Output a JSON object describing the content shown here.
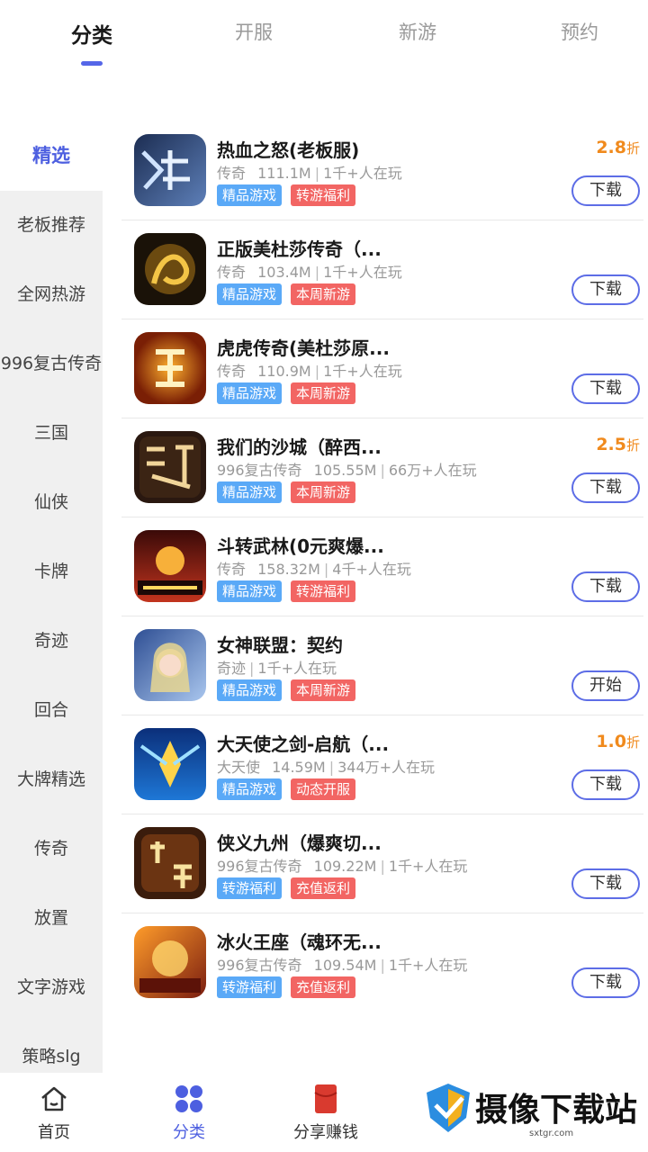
{
  "top_tabs": [
    {
      "label": "分类",
      "active": true
    },
    {
      "label": "开服",
      "active": false
    },
    {
      "label": "新游",
      "active": false
    },
    {
      "label": "预约",
      "active": false
    }
  ],
  "sidebar": [
    {
      "label": "精选",
      "active": true
    },
    {
      "label": "老板推荐"
    },
    {
      "label": "全网热游"
    },
    {
      "label": "996复古传奇"
    },
    {
      "label": "三国"
    },
    {
      "label": "仙侠"
    },
    {
      "label": "卡牌"
    },
    {
      "label": "奇迹"
    },
    {
      "label": "回合"
    },
    {
      "label": "大牌精选"
    },
    {
      "label": "传奇"
    },
    {
      "label": "放置"
    },
    {
      "label": "文字游戏"
    },
    {
      "label": "策略slg"
    }
  ],
  "games": [
    {
      "title": "热血之怒(老板服)",
      "category": "传奇",
      "size": "111.1M",
      "players": "1千+人在玩",
      "tags": [
        {
          "text": "精品游戏",
          "color": "blue"
        },
        {
          "text": "转游福利",
          "color": "red"
        }
      ],
      "discount": "2.8",
      "discount_unit": "折",
      "button": "下载",
      "icon": "ice-snow-game-icon"
    },
    {
      "title": "正版美杜莎传奇（...",
      "category": "传奇",
      "size": "103.4M",
      "players": "1千+人在玩",
      "tags": [
        {
          "text": "精品游戏",
          "color": "blue"
        },
        {
          "text": "本周新游",
          "color": "red"
        }
      ],
      "discount": "",
      "discount_unit": "",
      "button": "下载",
      "icon": "dragon-game-icon"
    },
    {
      "title": "虎虎传奇(美杜莎原...",
      "category": "传奇",
      "size": "110.9M",
      "players": "1千+人在玩",
      "tags": [
        {
          "text": "精品游戏",
          "color": "blue"
        },
        {
          "text": "本周新游",
          "color": "red"
        }
      ],
      "discount": "",
      "discount_unit": "",
      "button": "下载",
      "icon": "tiger-game-icon"
    },
    {
      "title": "我们的沙城（醉西...",
      "category": "996复古传奇",
      "size": "105.55M",
      "players": "66万+人在玩",
      "tags": [
        {
          "text": "精品游戏",
          "color": "blue"
        },
        {
          "text": "本周新游",
          "color": "red"
        }
      ],
      "discount": "2.5",
      "discount_unit": "折",
      "button": "下载",
      "icon": "zuixiyou-game-icon"
    },
    {
      "title": "斗转武林(0元爽爆...",
      "category": "传奇",
      "size": "158.32M",
      "players": "4千+人在玩",
      "tags": [
        {
          "text": "精品游戏",
          "color": "blue"
        },
        {
          "text": "转游福利",
          "color": "red"
        }
      ],
      "discount": "",
      "discount_unit": "",
      "button": "下载",
      "icon": "wulin-game-icon"
    },
    {
      "title": "女神联盟：契约",
      "category": "奇迹",
      "size": "",
      "players": "1千+人在玩",
      "tags": [
        {
          "text": "精品游戏",
          "color": "blue"
        },
        {
          "text": "本周新游",
          "color": "red"
        }
      ],
      "discount": "",
      "discount_unit": "",
      "button": "开始",
      "icon": "goddess-game-icon"
    },
    {
      "title": "大天使之剑-启航（...",
      "category": "大天使",
      "size": "14.59M",
      "players": "344万+人在玩",
      "tags": [
        {
          "text": "精品游戏",
          "color": "blue"
        },
        {
          "text": "动态开服",
          "color": "red"
        }
      ],
      "discount": "1.0",
      "discount_unit": "折",
      "button": "下载",
      "icon": "archangel-game-icon"
    },
    {
      "title": "侠义九州（爆爽切...",
      "category": "996复古传奇",
      "size": "109.22M",
      "players": "1千+人在玩",
      "tags": [
        {
          "text": "转游福利",
          "color": "blue"
        },
        {
          "text": "充值返利",
          "color": "red"
        }
      ],
      "discount": "",
      "discount_unit": "",
      "button": "下载",
      "icon": "chuanqi-game-icon"
    },
    {
      "title": "冰火王座（魂环无...",
      "category": "996复古传奇",
      "size": "109.54M",
      "players": "1千+人在玩",
      "tags": [
        {
          "text": "转游福利",
          "color": "blue"
        },
        {
          "text": "充值返利",
          "color": "red"
        }
      ],
      "discount": "",
      "discount_unit": "",
      "button": "下载",
      "icon": "ice-fire-game-icon"
    }
  ],
  "bottom_nav": [
    {
      "label": "首页",
      "icon": "home-icon",
      "active": false
    },
    {
      "label": "分类",
      "icon": "category-grid-icon",
      "active": true
    },
    {
      "label": "分享赚钱",
      "icon": "red-envelope-icon",
      "active": false
    }
  ],
  "watermark": {
    "text": "摄像下载站",
    "url": "sxtgr.com"
  },
  "colors": {
    "accent": "#4d5fe0",
    "discount": "#f08a1d",
    "tag_blue": "#5aa9f7",
    "tag_red": "#f26563"
  }
}
